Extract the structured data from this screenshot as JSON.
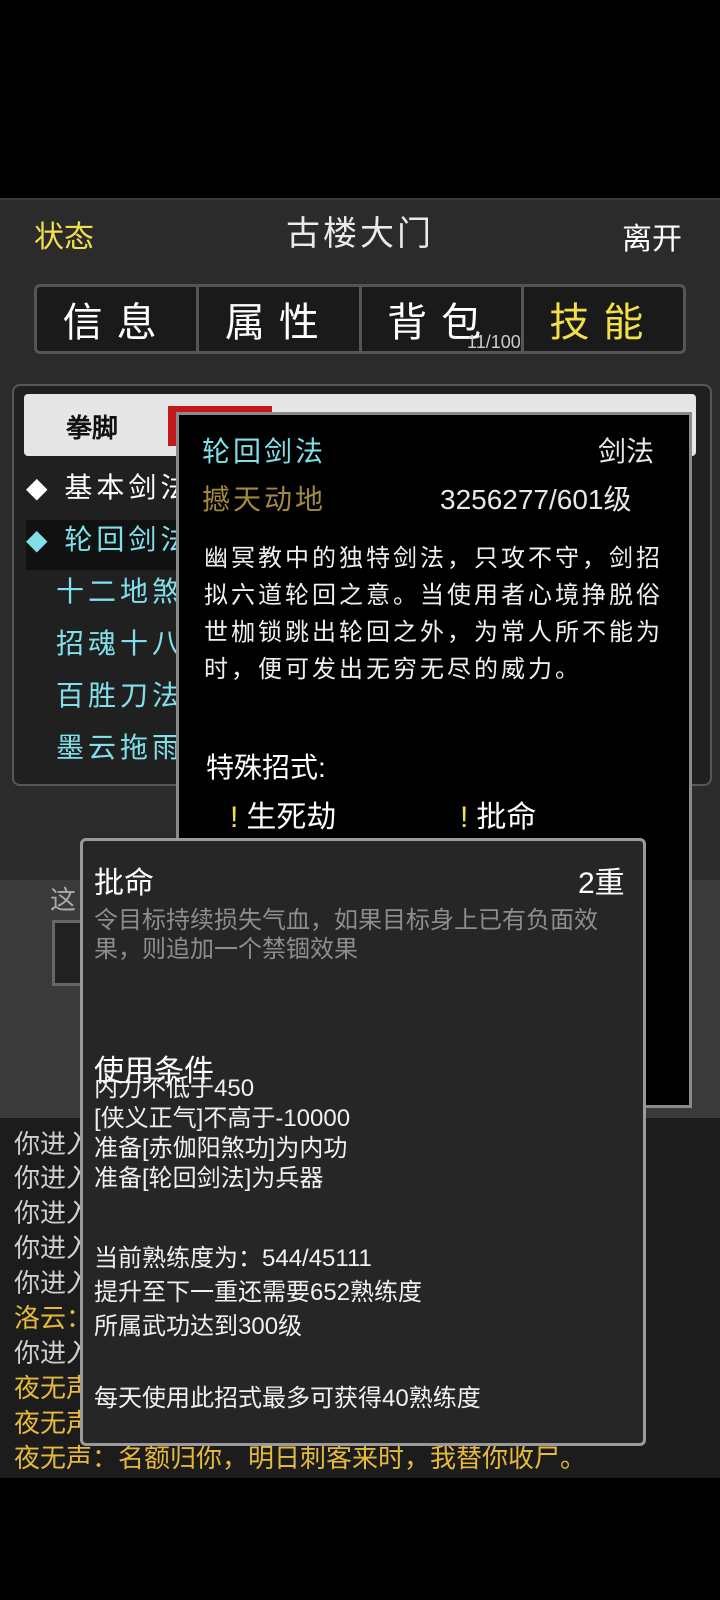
{
  "header": {
    "status_label": "状态",
    "location_title": "古楼大门",
    "leave_label": "离开"
  },
  "tabs": [
    {
      "label": "信息"
    },
    {
      "label": "属性"
    },
    {
      "label": "背包"
    },
    {
      "label": "技能"
    }
  ],
  "bag_count": "11/100",
  "filter": {
    "active": "拳脚"
  },
  "skill_list": [
    "◆ 基本剑法",
    "◆ 轮回剑法",
    "十二地煞",
    "招魂十八",
    "百胜刀法",
    "墨云拖雨"
  ],
  "skill_detail": {
    "name": "轮回剑法",
    "type": "剑法",
    "tier": "撼天动地",
    "level": "3256277/601级",
    "description": "幽冥教中的独特剑法，只攻不守，剑招拟六道轮回之意。当使用者心境挣脱俗世枷锁跳出轮回之外，为常人所不能为时，便可发出无穷无尽的威力。",
    "special_heading": "特殊招式:",
    "special_moves": [
      "生死劫",
      "批命"
    ],
    "bang": "!"
  },
  "move_tooltip": {
    "name": "批命",
    "rank": "2重",
    "effect": "令目标持续损失气血，如果目标身上已有负面效果，则追加一个禁锢效果",
    "conditions_heading": "使用条件",
    "conditions": [
      "内力不低于450",
      "[侠义正气]不高于-10000",
      "准备[赤伽阳煞功]为内功",
      "准备[轮回剑法]为兵器"
    ],
    "progress": [
      "当前熟练度为：544/45111",
      "提升至下一重还需要652熟练度",
      "所属武功达到300级"
    ],
    "daily_cap": "每天使用此招式最多可获得40熟练度"
  },
  "bottom_strip_text": "这",
  "log": [
    {
      "text": "你进入",
      "color": "gray"
    },
    {
      "text": "你进入",
      "color": "gray"
    },
    {
      "text": "你进入",
      "color": "gray"
    },
    {
      "text": "你进入",
      "color": "gray"
    },
    {
      "text": "你进入",
      "color": "gray"
    },
    {
      "text": "洛云：",
      "color": "gold"
    },
    {
      "text": "你进入",
      "color": "gray"
    },
    {
      "text": "夜无声",
      "color": "gold"
    },
    {
      "text": "夜无声",
      "color": "gold"
    },
    {
      "text": "夜无声：名额归你，明日刺客来时，我替你收尸。",
      "color": "gold"
    }
  ],
  "colors": {
    "accent_yellow": "#f2e04a",
    "skill_cyan": "#7fe0ea",
    "tier_gold": "#a28a3d",
    "log_gold": "#e6b93a"
  }
}
